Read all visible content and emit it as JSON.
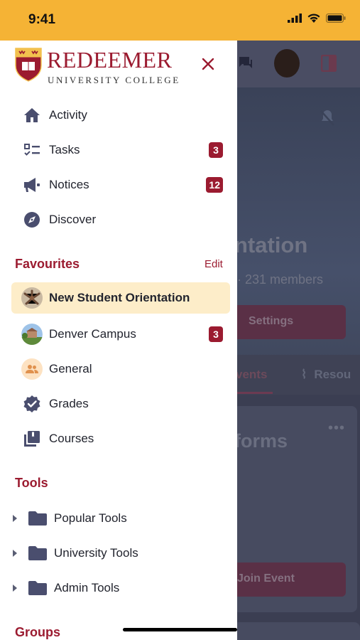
{
  "status_bar": {
    "time": "9:41"
  },
  "brand": {
    "name": "REDEEMER",
    "subtitle": "UNIVERSITY COLLEGE"
  },
  "nav": {
    "items": [
      {
        "label": "Activity",
        "icon": "home-icon"
      },
      {
        "label": "Tasks",
        "icon": "checklist-icon",
        "badge": "3"
      },
      {
        "label": "Notices",
        "icon": "megaphone-icon",
        "badge": "12"
      },
      {
        "label": "Discover",
        "icon": "compass-icon"
      }
    ]
  },
  "favourites": {
    "title": "Favourites",
    "edit_label": "Edit",
    "items": [
      {
        "label": "New Student Orientation",
        "selected": true
      },
      {
        "label": "Denver Campus",
        "badge": "3"
      },
      {
        "label": "General"
      },
      {
        "label": "Grades"
      },
      {
        "label": "Courses"
      }
    ]
  },
  "tools": {
    "title": "Tools",
    "items": [
      {
        "label": "Popular Tools"
      },
      {
        "label": "University Tools"
      },
      {
        "label": "Admin Tools"
      }
    ]
  },
  "groups": {
    "title": "Groups"
  },
  "background": {
    "group_title": "ntation",
    "members": "· 231 members",
    "settings_label": "Settings",
    "tab_events": "vents",
    "tab_resources": "Resou",
    "card_title": "forms",
    "join_label": "Join Event"
  },
  "colors": {
    "brand": "#9b1b30",
    "status_bar": "#f5b335",
    "selected_bg": "#fdedc9",
    "icon": "#4a4e6e"
  }
}
